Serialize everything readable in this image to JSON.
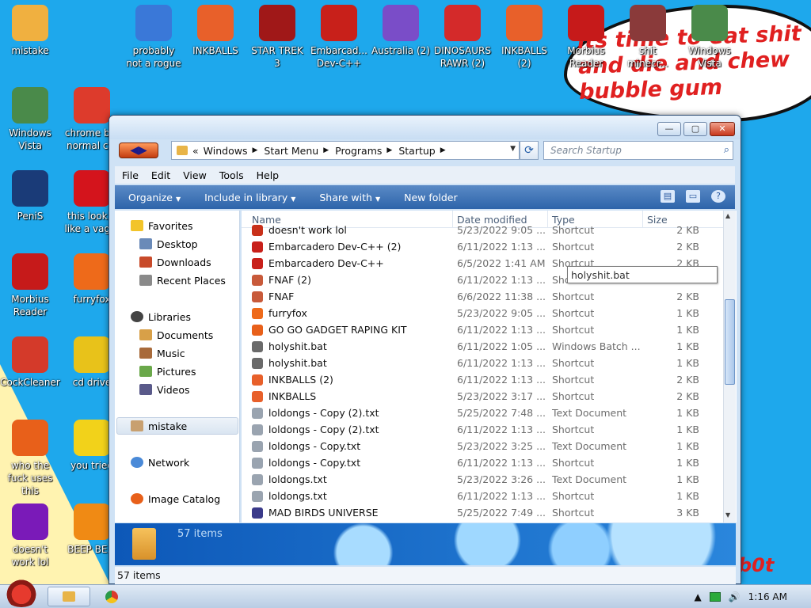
{
  "wallpaper": {
    "bubble_text": "its time to eat shit and die and chew bubble gum",
    "corner_text": "b0t"
  },
  "desktop_icons": [
    {
      "label": "mistake",
      "icon": "folder-image-icon",
      "color": "#f0b040"
    },
    {
      "label": "probably not a rogue",
      "icon": "gear-monitor-icon",
      "color": "#3a78d8"
    },
    {
      "label": "INKBALLS",
      "icon": "paint-ball-icon",
      "color": "#e8602a"
    },
    {
      "label": "STAR TREK 3",
      "icon": "star-wars-icon",
      "color": "#a01818"
    },
    {
      "label": "Embarcad... Dev-C++",
      "icon": "devcpp-icon",
      "color": "#c8201a"
    },
    {
      "label": "Australia (2)",
      "icon": "spider-icon",
      "color": "#7a4dc8"
    },
    {
      "label": "DINOSAURS RAWR (2)",
      "icon": "angry-bird-icon",
      "color": "#d42a2a"
    },
    {
      "label": "INKBALLS (2)",
      "icon": "paint-ball-icon",
      "color": "#e8602a"
    },
    {
      "label": "Morbius Reader",
      "icon": "pdf-reader-icon",
      "color": "#c61a1a"
    },
    {
      "label": "shit minecr...",
      "icon": "minecraft-icon",
      "color": "#8a3a3a"
    },
    {
      "label": "Windows Vista",
      "icon": "recycle-bin-icon",
      "color": "#4a8a4a"
    },
    {
      "label": "Windows Vista",
      "icon": "recycle-bin-icon",
      "color": "#4a8a4a"
    },
    {
      "label": "chrome b... normal c...",
      "icon": "chrome-icon",
      "color": "#dd3b2c"
    },
    {
      "label": "PeniS",
      "icon": "photoshop-icon",
      "color": "#1a3b78"
    },
    {
      "label": "this look... like a vag...",
      "icon": "opera-icon",
      "color": "#d4141c"
    },
    {
      "label": "Morbius Reader",
      "icon": "pdf-reader-icon",
      "color": "#c61a1a"
    },
    {
      "label": "furryfox",
      "icon": "firefox-icon",
      "color": "#ee6a1a"
    },
    {
      "label": "CockCleaner",
      "icon": "ccleaner-icon",
      "color": "#d43a2a"
    },
    {
      "label": "cd drive",
      "icon": "cd-icon",
      "color": "#e8c21a"
    },
    {
      "label": "who the fuck uses this",
      "icon": "winamp-icon",
      "color": "#e8601a"
    },
    {
      "label": "you tried",
      "icon": "star-icon",
      "color": "#f2d21a"
    },
    {
      "label": "doesn't work lol",
      "icon": "yahoo-messenger-icon",
      "color": "#7a1ab8"
    },
    {
      "label": "BEEP BE...",
      "icon": "vlc-icon",
      "color": "#f08a14"
    }
  ],
  "window": {
    "title": "",
    "buttons": {
      "minimize": "—",
      "maximize": "▢",
      "close": "✕"
    },
    "nav_arrows": "◀▶",
    "breadcrumb": [
      "Windows",
      "Start Menu",
      "Programs",
      "Startup"
    ],
    "breadcrumb_prefix": "«",
    "search_placeholder": "Search Startup",
    "menu": [
      "File",
      "Edit",
      "View",
      "Tools",
      "Help"
    ],
    "commands": [
      "Organize",
      "Include in library",
      "Share with",
      "New folder"
    ],
    "nav": {
      "favorites_label": "Favorites",
      "favorites": [
        "Desktop",
        "Downloads",
        "Recent Places"
      ],
      "libraries_label": "Libraries",
      "libraries": [
        "Documents",
        "Music",
        "Pictures",
        "Videos"
      ],
      "selected": "mistake",
      "network": "Network",
      "image_catalog": "Image Catalog"
    },
    "columns": [
      "Name",
      "Date modified",
      "Type",
      "Size"
    ],
    "files": [
      {
        "name": "doesn't work lol",
        "date": "5/23/2022 9:05 ...",
        "type": "Shortcut",
        "size": "2 KB",
        "color": "#c8301a"
      },
      {
        "name": "Embarcadero Dev-C++ (2)",
        "date": "6/11/2022 1:13 ...",
        "type": "Shortcut",
        "size": "2 KB",
        "color": "#c8201a"
      },
      {
        "name": "Embarcadero Dev-C++",
        "date": "6/5/2022 1:41 AM",
        "type": "Shortcut",
        "size": "2 KB",
        "color": "#c8201a"
      },
      {
        "name": "FNAF (2)",
        "date": "6/11/2022 1:13 ...",
        "type": "Shortcut",
        "size": "2 KB",
        "color": "#c85a3a"
      },
      {
        "name": "FNAF",
        "date": "6/6/2022 11:38 ...",
        "type": "Shortcut",
        "size": "2 KB",
        "color": "#c85a3a"
      },
      {
        "name": "furryfox",
        "date": "5/23/2022 9:05 ...",
        "type": "Shortcut",
        "size": "1 KB",
        "color": "#ee6a1a"
      },
      {
        "name": "GO GO GADGET RAPING KIT",
        "date": "6/11/2022 1:13 ...",
        "type": "Shortcut",
        "size": "1 KB",
        "color": "#e8601a"
      },
      {
        "name": "holyshit.bat",
        "date": "6/11/2022 1:05 ...",
        "type": "Windows Batch ...",
        "size": "1 KB",
        "color": "#6a6a6a"
      },
      {
        "name": "holyshit.bat",
        "date": "6/11/2022 1:13 ...",
        "type": "Shortcut",
        "size": "1 KB",
        "color": "#6a6a6a"
      },
      {
        "name": "INKBALLS (2)",
        "date": "6/11/2022 1:13 ...",
        "type": "Shortcut",
        "size": "2 KB",
        "color": "#e8602a"
      },
      {
        "name": "INKBALLS",
        "date": "5/23/2022 3:17 ...",
        "type": "Shortcut",
        "size": "2 KB",
        "color": "#e8602a"
      },
      {
        "name": "loldongs - Copy (2).txt",
        "date": "5/25/2022 7:48 ...",
        "type": "Text Document",
        "size": "1 KB",
        "color": "#9aa4b0"
      },
      {
        "name": "loldongs - Copy (2).txt",
        "date": "6/11/2022 1:13 ...",
        "type": "Shortcut",
        "size": "1 KB",
        "color": "#9aa4b0"
      },
      {
        "name": "loldongs - Copy.txt",
        "date": "5/23/2022 3:25 ...",
        "type": "Text Document",
        "size": "1 KB",
        "color": "#9aa4b0"
      },
      {
        "name": "loldongs - Copy.txt",
        "date": "6/11/2022 1:13 ...",
        "type": "Shortcut",
        "size": "1 KB",
        "color": "#9aa4b0"
      },
      {
        "name": "loldongs.txt",
        "date": "5/23/2022 3:26 ...",
        "type": "Text Document",
        "size": "1 KB",
        "color": "#9aa4b0"
      },
      {
        "name": "loldongs.txt",
        "date": "6/11/2022 1:13 ...",
        "type": "Shortcut",
        "size": "1 KB",
        "color": "#9aa4b0"
      },
      {
        "name": "MAD BIRDS UNIVERSE",
        "date": "5/25/2022 7:49 ...",
        "type": "Shortcut",
        "size": "3 KB",
        "color": "#3a3a8a"
      }
    ],
    "tooltip": "holyshit.bat",
    "details_count": "57 items",
    "status": "57 items"
  },
  "taskbar": {
    "time": "1:16 AM"
  }
}
